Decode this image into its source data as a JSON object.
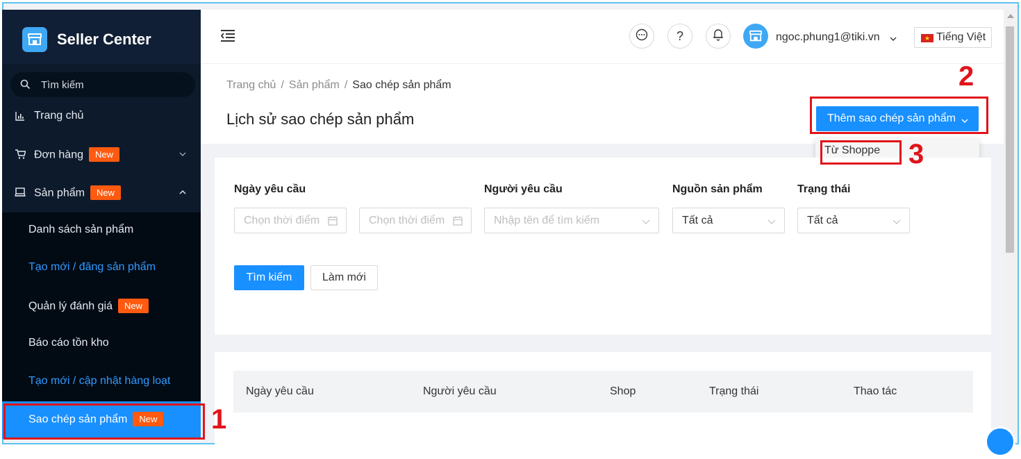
{
  "brand": {
    "title": "Seller Center",
    "icon": "store-icon"
  },
  "search": {
    "placeholder": "Tìm kiếm"
  },
  "nav": [
    {
      "label": "Trang chủ",
      "icon": "bar-chart-icon"
    },
    {
      "label": "Đơn hàng",
      "badge": "New",
      "icon": "cart-icon"
    },
    {
      "label": "Sản phẩm",
      "badge": "New",
      "icon": "laptop-icon"
    }
  ],
  "submenu": [
    {
      "label": "Danh sách sản phẩm"
    },
    {
      "label": "Tạo mới / đăng sản phẩm"
    },
    {
      "label": "Quản lý đánh giá",
      "badge": "New"
    },
    {
      "label": "Báo cáo tồn kho"
    },
    {
      "label": "Tạo mới / cập nhật hàng loạt"
    },
    {
      "label": "Sao chép sản phẩm",
      "badge": "New"
    }
  ],
  "header": {
    "user": "ngoc.phung1@tiki.vn",
    "language": "Tiếng Việt",
    "help": "?"
  },
  "breadcrumb": {
    "items": [
      "Trang chủ",
      "Sản phẩm",
      "Sao chép sản phẩm"
    ],
    "separator": "/"
  },
  "page_title": "Lịch sử sao chép sản phẩm",
  "add_button": {
    "label": "Thêm sao chép sản phẩm"
  },
  "dropdown": {
    "options": [
      "Từ Shoppe"
    ]
  },
  "filters": {
    "date_label": "Ngày yêu cầu",
    "date_from_placeholder": "Chọn thời điểm",
    "date_to_placeholder": "Chọn thời điểm",
    "requester_label": "Người yêu cầu",
    "requester_placeholder": "Nhập tên để tìm kiếm",
    "source_label": "Nguồn sản phẩm",
    "source_value": "Tất cả",
    "status_label": "Trạng thái",
    "status_value": "Tất cả",
    "search_button": "Tìm kiếm",
    "reset_button": "Làm mới"
  },
  "table": {
    "columns": [
      "Ngày yêu cầu",
      "Người yêu cầu",
      "Shop",
      "Trạng thái",
      "Thao tác"
    ]
  },
  "annotations": [
    "1",
    "2",
    "3"
  ],
  "colors": {
    "primary": "#1990ff",
    "badge": "#ff5a10",
    "annotation": "#e0141b",
    "sidebar": "#0d1a2b"
  }
}
